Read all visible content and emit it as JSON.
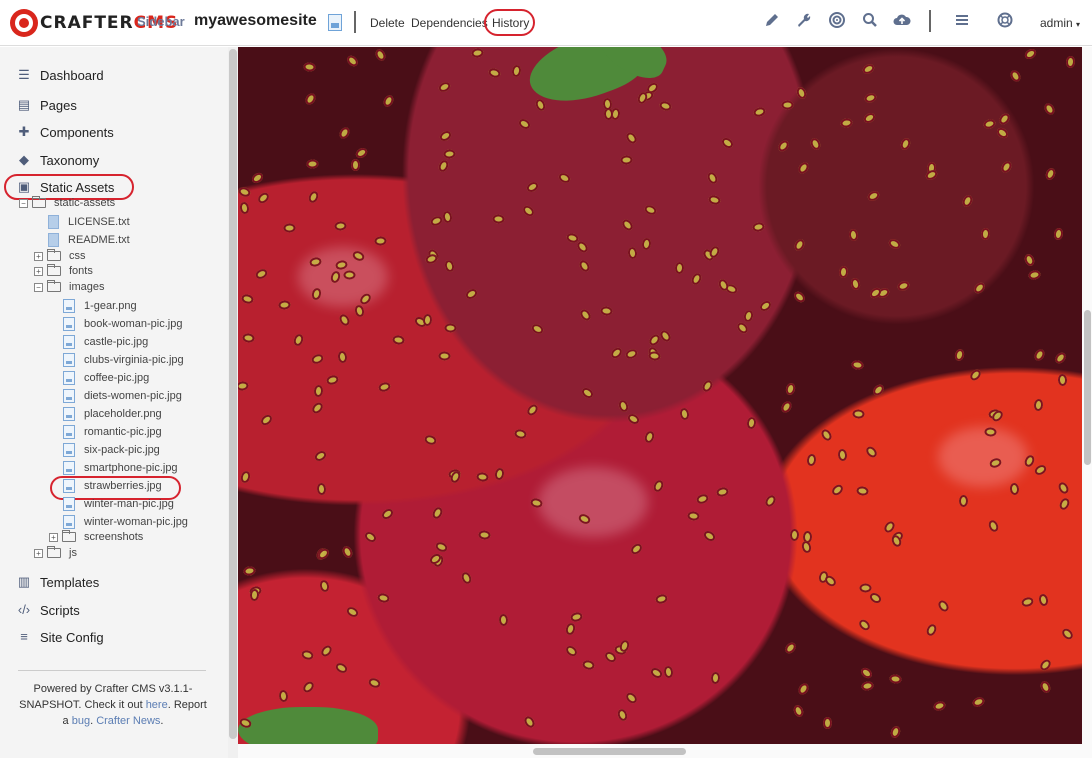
{
  "topbar": {
    "logo_part1": "CRAFTER",
    "logo_part2": "CMS",
    "sidebar_label": "Sidebar",
    "site_name": "myawesomesite",
    "actions": [
      "Delete",
      "Dependencies",
      "History"
    ],
    "icons": [
      "pencil-icon",
      "wrench-icon",
      "target-icon",
      "search-icon",
      "cloud-upload-icon",
      "menu-icon",
      "help-lifebuoy-icon"
    ],
    "user": "admin"
  },
  "sidebar": {
    "nav_top": [
      "Dashboard",
      "Pages",
      "Components",
      "Taxonomy",
      "Static Assets"
    ],
    "tree": {
      "root": "static-assets",
      "root_files": [
        "LICENSE.txt",
        "README.txt"
      ],
      "folders_collapsed_1": [
        "css",
        "fonts"
      ],
      "images_folder": "images",
      "images": [
        "1-gear.png",
        "book-woman-pic.jpg",
        "castle-pic.jpg",
        "clubs-virginia-pic.jpg",
        "coffee-pic.jpg",
        "diets-women-pic.jpg",
        "placeholder.png",
        "romantic-pic.jpg",
        "six-pack-pic.jpg",
        "smartphone-pic.jpg",
        "strawberries.jpg",
        "winter-man-pic.jpg",
        "winter-woman-pic.jpg"
      ],
      "screenshots": "screenshots",
      "js": "js"
    },
    "nav_bottom": [
      "Templates",
      "Scripts",
      "Site Config"
    ],
    "footer": {
      "line1": "Powered by Crafter CMS v3.1.1-",
      "line2a": "SNAPSHOT. Check it out ",
      "here": "here",
      "line2b": ". Report",
      "line3a": "a ",
      "bug": "bug",
      "line3b": ". ",
      "news": "Crafter News",
      "line3c": "."
    }
  },
  "preview": {
    "image_subject": "close-up of strawberries",
    "highlighted_file": "strawberries.jpg"
  },
  "colors": {
    "brand_red": "#d9261c",
    "annotation_red": "#d6232e",
    "nav_icon": "#4f5d7a",
    "link": "#5b7db3"
  }
}
